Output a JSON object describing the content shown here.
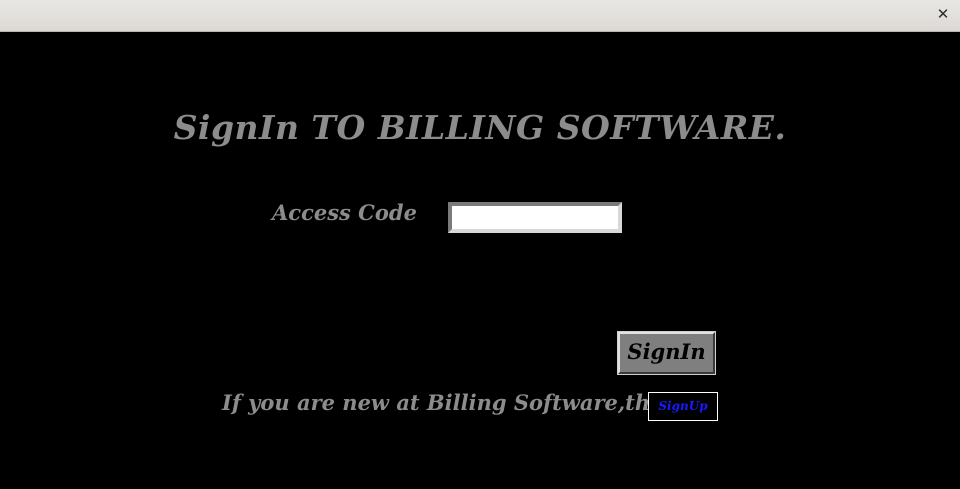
{
  "window": {
    "close_glyph": "✕",
    "close_icon": "close-icon"
  },
  "form": {
    "heading": "SignIn TO BILLING SOFTWARE.",
    "access_code_label": "Access Code",
    "access_code_value": "",
    "signin_label": "SignIn",
    "new_user_text": "If you are new at Billing Software,then",
    "signup_label": "SignUp"
  },
  "colors": {
    "background": "#000000",
    "label_text": "#8c8c8c",
    "signin_button_bg": "#7f7f7f",
    "signup_text": "#1a1aff"
  }
}
